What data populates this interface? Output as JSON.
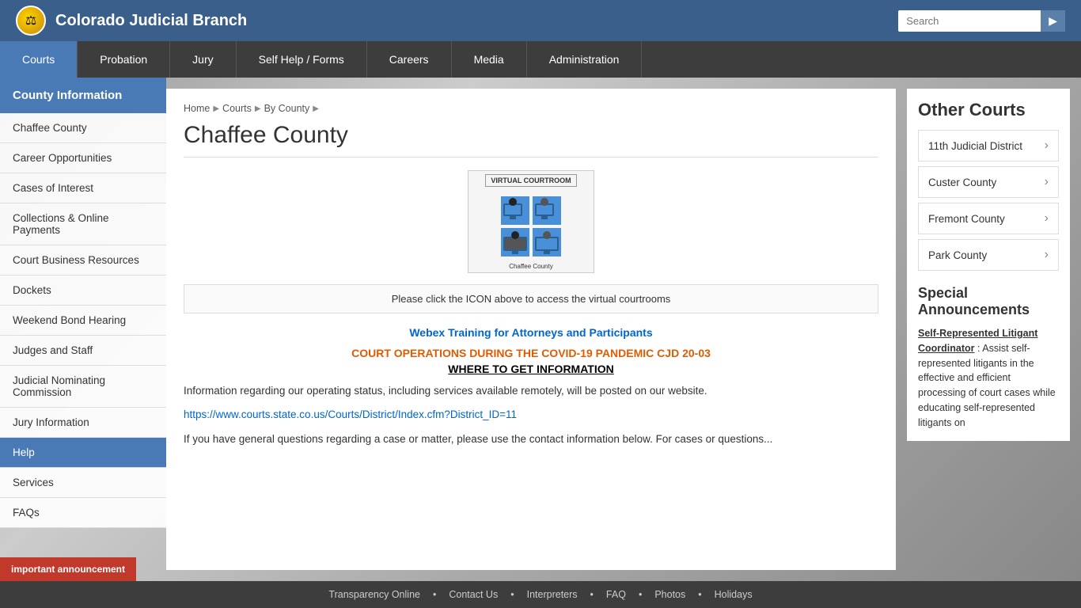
{
  "site": {
    "title": "Colorado Judicial Branch",
    "logo_emoji": "⚖"
  },
  "header": {
    "search_placeholder": "Search",
    "search_button": "▶"
  },
  "main_nav": {
    "items": [
      {
        "label": "Courts",
        "active": true
      },
      {
        "label": "Probation",
        "active": false
      },
      {
        "label": "Jury",
        "active": false
      },
      {
        "label": "Self Help / Forms",
        "active": false
      },
      {
        "label": "Careers",
        "active": false
      },
      {
        "label": "Media",
        "active": false
      },
      {
        "label": "Administration",
        "active": false
      }
    ]
  },
  "sidebar": {
    "heading": "County Information",
    "items": [
      {
        "label": "Chaffee County",
        "active": false
      },
      {
        "label": "Career Opportunities",
        "active": false
      },
      {
        "label": "Cases of Interest",
        "active": false
      },
      {
        "label": "Collections & Online Payments",
        "active": false
      },
      {
        "label": "Court Business Resources",
        "active": false
      },
      {
        "label": "Dockets",
        "active": false
      },
      {
        "label": "Weekend Bond Hearing",
        "active": false
      },
      {
        "label": "Judges and Staff",
        "active": false
      },
      {
        "label": "Judicial Nominating Commission",
        "active": false
      },
      {
        "label": "Jury Information",
        "active": false
      },
      {
        "label": "Help",
        "active": true
      },
      {
        "label": "Services",
        "active": false
      },
      {
        "label": "FAQs",
        "active": false
      }
    ]
  },
  "breadcrumb": {
    "items": [
      "Home",
      "Courts",
      "By County"
    ]
  },
  "content": {
    "page_title": "Chaffee County",
    "virtual_courtroom_label": "VIRTUAL COURTROOM",
    "county_label": "Chaffee County",
    "click_icon_note": "Please click the ICON above to access the virtual courtrooms",
    "webex_link": "Webex Training for Attorneys and Participants",
    "court_ops_title": "COURT OPERATIONS DURING THE COVID-19 PANDEMIC CJD",
    "court_ops_number": "20-03",
    "where_info": "WHERE TO GET INFORMATION",
    "body_text_1": "Information regarding our operating status, including services available remotely, will be posted on our website.",
    "content_link": "https://www.courts.state.co.us/Courts/District/Index.cfm?District_ID=11",
    "body_text_2": "If you have general questions regarding a case or matter, please use the contact information below.  For cases or questions..."
  },
  "other_courts": {
    "title": "Other Courts",
    "courts": [
      {
        "label": "11th Judicial District"
      },
      {
        "label": "Custer County"
      },
      {
        "label": "Fremont County"
      },
      {
        "label": "Park County"
      }
    ]
  },
  "special_announcements": {
    "title": "Special Announcements",
    "link_text": "Self-Represented Litigant Coordinator",
    "body": ": Assist self-represented litigants in the effective and efficient processing of court cases while educating self-represented litigants on"
  },
  "footer": {
    "items": [
      "Transparency Online",
      "Contact Us",
      "Interpreters",
      "FAQ",
      "Photos",
      "Holidays"
    ]
  },
  "important_announcement": {
    "label": "important announcement"
  }
}
